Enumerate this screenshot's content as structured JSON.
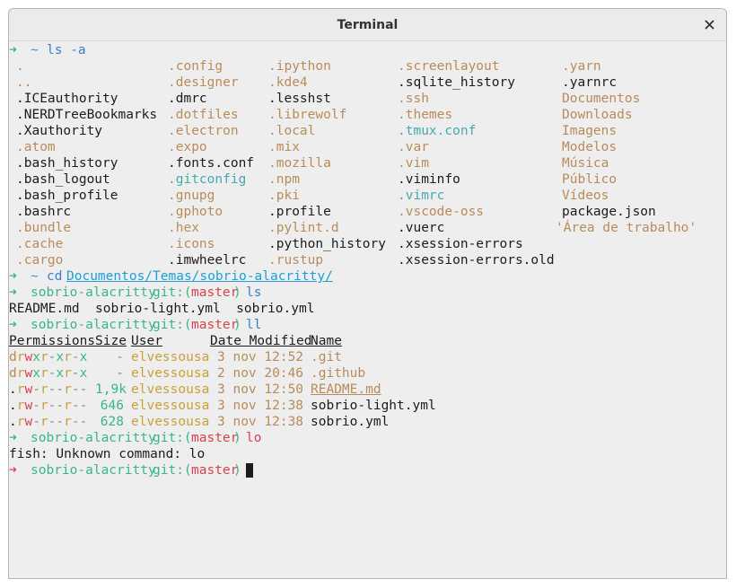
{
  "window": {
    "title": "Terminal"
  },
  "prompt": {
    "arrow": "➜",
    "tilde": "~"
  },
  "line1": {
    "cmd": "ls -a"
  },
  "ls_columns": [
    [
      {
        "t": ".",
        "c": "orange"
      },
      {
        "t": "..",
        "c": "orange"
      },
      {
        "t": ".ICEauthority",
        "c": "plain"
      },
      {
        "t": ".NERDTreeBookmarks",
        "c": "plain"
      },
      {
        "t": ".Xauthority",
        "c": "plain"
      },
      {
        "t": ".atom",
        "c": "orange"
      },
      {
        "t": ".bash_history",
        "c": "plain"
      },
      {
        "t": ".bash_logout",
        "c": "plain"
      },
      {
        "t": ".bash_profile",
        "c": "plain"
      },
      {
        "t": ".bashrc",
        "c": "plain"
      },
      {
        "t": ".bundle",
        "c": "orange"
      },
      {
        "t": ".cache",
        "c": "orange"
      },
      {
        "t": ".cargo",
        "c": "orange"
      }
    ],
    [
      {
        "t": ".config",
        "c": "orange"
      },
      {
        "t": ".designer",
        "c": "orange"
      },
      {
        "t": ".dmrc",
        "c": "plain"
      },
      {
        "t": ".dotfiles",
        "c": "orange"
      },
      {
        "t": ".electron",
        "c": "orange"
      },
      {
        "t": ".expo",
        "c": "orange"
      },
      {
        "t": ".fonts.conf",
        "c": "plain"
      },
      {
        "t": ".gitconfig",
        "c": "cyan"
      },
      {
        "t": ".gnupg",
        "c": "orange"
      },
      {
        "t": ".gphoto",
        "c": "orange"
      },
      {
        "t": ".hex",
        "c": "orange"
      },
      {
        "t": ".icons",
        "c": "orange"
      },
      {
        "t": ".imwheelrc",
        "c": "plain"
      }
    ],
    [
      {
        "t": ".ipython",
        "c": "orange"
      },
      {
        "t": ".kde4",
        "c": "orange"
      },
      {
        "t": ".lesshst",
        "c": "plain"
      },
      {
        "t": ".librewolf",
        "c": "orange"
      },
      {
        "t": ".local",
        "c": "orange"
      },
      {
        "t": ".mix",
        "c": "orange"
      },
      {
        "t": ".mozilla",
        "c": "orange"
      },
      {
        "t": ".npm",
        "c": "orange"
      },
      {
        "t": ".pki",
        "c": "orange"
      },
      {
        "t": ".profile",
        "c": "plain"
      },
      {
        "t": ".pylint.d",
        "c": "orange"
      },
      {
        "t": ".python_history",
        "c": "plain"
      },
      {
        "t": ".rustup",
        "c": "orange"
      }
    ],
    [
      {
        "t": ".screenlayout",
        "c": "orange"
      },
      {
        "t": ".sqlite_history",
        "c": "plain"
      },
      {
        "t": ".ssh",
        "c": "orange"
      },
      {
        "t": ".themes",
        "c": "orange"
      },
      {
        "t": ".tmux.conf",
        "c": "cyan"
      },
      {
        "t": ".var",
        "c": "orange"
      },
      {
        "t": ".vim",
        "c": "orange"
      },
      {
        "t": ".viminfo",
        "c": "plain"
      },
      {
        "t": ".vimrc",
        "c": "cyan"
      },
      {
        "t": ".vscode-oss",
        "c": "orange"
      },
      {
        "t": ".vuerc",
        "c": "plain"
      },
      {
        "t": ".xsession-errors",
        "c": "plain"
      },
      {
        "t": ".xsession-errors.old",
        "c": "plain"
      }
    ],
    [
      {
        "t": ".yarn",
        "c": "orange"
      },
      {
        "t": ".yarnrc",
        "c": "plain"
      },
      {
        "t": "Documentos",
        "c": "orange"
      },
      {
        "t": "Downloads",
        "c": "orange"
      },
      {
        "t": "Imagens",
        "c": "orange"
      },
      {
        "t": "Modelos",
        "c": "orange"
      },
      {
        "t": "Música",
        "c": "orange"
      },
      {
        "t": "Público",
        "c": "orange"
      },
      {
        "t": "Vídeos",
        "c": "orange"
      },
      {
        "t": "package.json",
        "c": "plain"
      },
      {
        "t": "'Área de trabalho'",
        "c": "orange"
      }
    ]
  ],
  "line_cd": {
    "cmd": "cd",
    "path": "Documentos/Temas/sobrio-alacritty/"
  },
  "prompt_dir": "sobrio-alacritty",
  "git_label": "git:(",
  "branch": "master",
  "git_close": ")",
  "line_ls": {
    "cmd": "ls",
    "output": "README.md  sobrio-light.yml  sobrio.yml"
  },
  "line_ll": {
    "cmd": "ll"
  },
  "ll_headers": [
    "Permissions",
    "Size",
    "User",
    "Date Modified",
    "Name"
  ],
  "ll_rows": [
    {
      "perm": "drwxr-xr-x",
      "size": "-",
      "user": "elvessousa",
      "date": "3 nov 12:52",
      "name": ".git",
      "name_c": "orange",
      "underline": false
    },
    {
      "perm": "drwxr-xr-x",
      "size": "-",
      "user": "elvessousa",
      "date": "2 nov 20:46",
      "name": ".github",
      "name_c": "orange",
      "underline": false
    },
    {
      "perm": ".rw-r--r--",
      "size": "1,9k",
      "user": "elvessousa",
      "date": "3 nov 12:50",
      "name": "README.md",
      "name_c": "orange",
      "underline": true
    },
    {
      "perm": ".rw-r--r--",
      "size": "646",
      "user": "elvessousa",
      "date": "3 nov 12:38",
      "name": "sobrio-light.yml",
      "name_c": "plain",
      "underline": false
    },
    {
      "perm": ".rw-r--r--",
      "size": "628",
      "user": "elvessousa",
      "date": "3 nov 12:38",
      "name": "sobrio.yml",
      "name_c": "plain",
      "underline": false
    }
  ],
  "line_lo": {
    "cmd": "lo",
    "output": "fish: Unknown command: lo"
  }
}
